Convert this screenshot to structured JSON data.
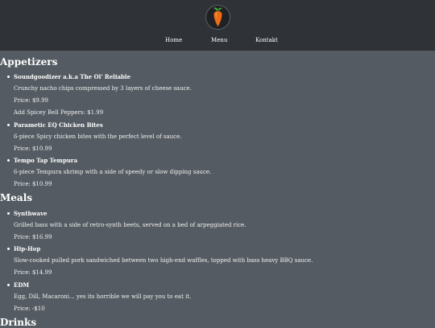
{
  "header": {
    "logo_icon": "carrot-logo-icon",
    "nav": {
      "home": "Home",
      "menu": "Menu",
      "kontakt": "Kontakt"
    }
  },
  "colors": {
    "header_bg": "#2f3236",
    "page_bg": "#545b62",
    "text": "#ffffff",
    "logo_orange": "#ee6c15"
  },
  "menu": {
    "appetizers": {
      "title": "Appetizers",
      "items": [
        {
          "name": "Soundgoodizer a.k.a The Ol' Reliable",
          "description": "Crunchy nacho chips compressed by 3 layers of cheese sauce.",
          "price": "Price: $9.99",
          "extra": "Add Spicey Bell Peppers: $1.99"
        },
        {
          "name": "Parametic EQ Chicken Bites",
          "description": "6-piece Spicy chicken bites with the perfect level of sauce.",
          "price": "Price: $10.99"
        },
        {
          "name": "Tempo Tap Tempura",
          "description": "6-piece Tempura shrimp with a side of speedy or slow dipping sauce.",
          "price": "Price: $10.99"
        }
      ]
    },
    "meals": {
      "title": "Meals",
      "items": [
        {
          "name": "Synthwave",
          "description": "Grilled bass with a side of retro-synth beets, served on a bed of arpeggiated rice.",
          "price": "Price: $16.99"
        },
        {
          "name": "Hip-Hop",
          "description": "Slow-cooked pulled pork sandwiched between two high-end waffles, topped with bass heavy BBQ sauce.",
          "price": "Price: $14.99"
        },
        {
          "name": "EDM",
          "description": "Egg, Dill, Macaroni... yes its horrible we will pay you to eat it.",
          "price": "Price: -$10"
        }
      ]
    },
    "drinks": {
      "title": "Drinks"
    }
  }
}
